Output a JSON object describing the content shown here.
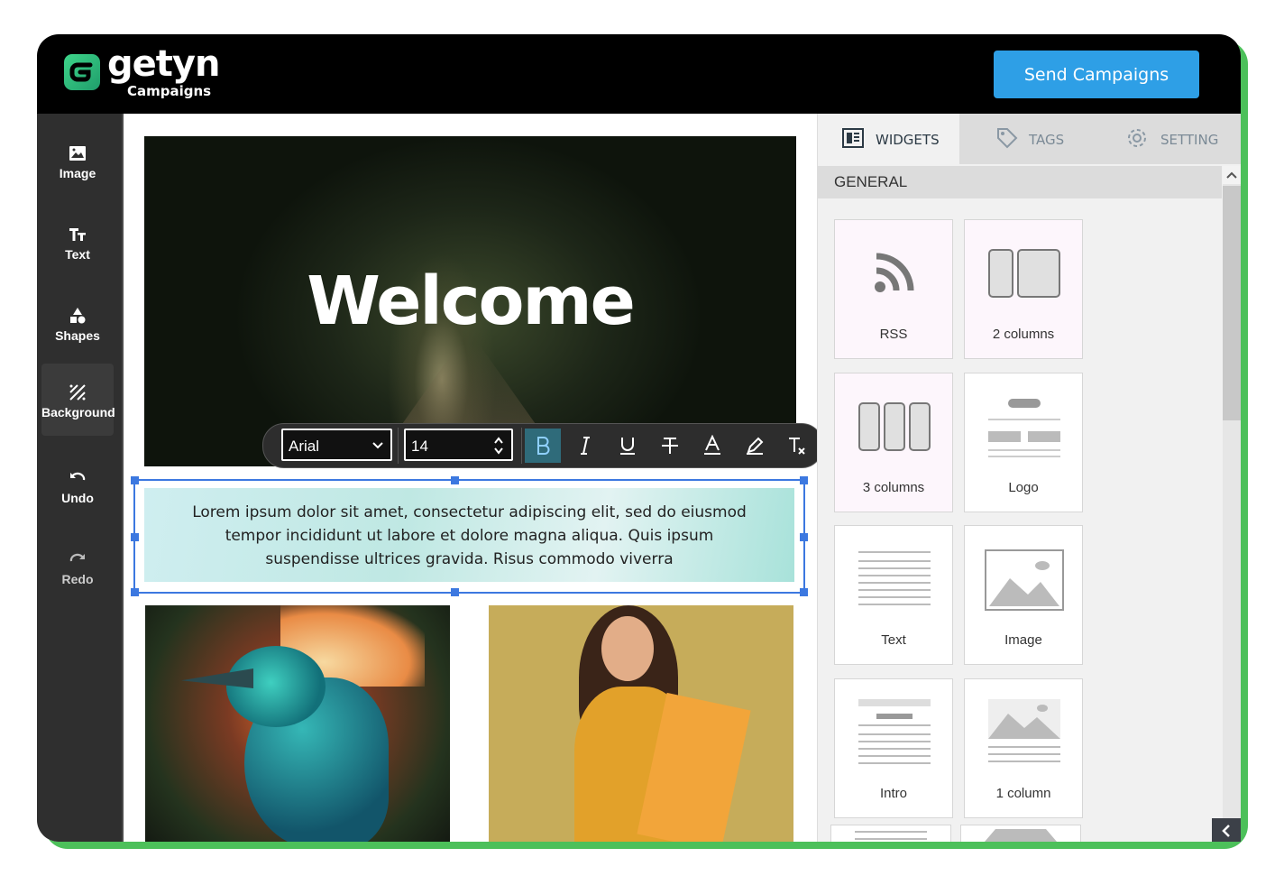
{
  "brand": {
    "name": "getyn",
    "sub": "Campaigns",
    "accent": "#4cc05a"
  },
  "header": {
    "send_label": "Send Campaigns",
    "send_color": "#2e9fe6"
  },
  "sidebar": {
    "items": [
      {
        "label": "Image",
        "icon": "image-icon"
      },
      {
        "label": "Text",
        "icon": "text-icon"
      },
      {
        "label": "Shapes",
        "icon": "shapes-icon"
      },
      {
        "label": "Background",
        "icon": "background-icon"
      },
      {
        "label": "Undo",
        "icon": "undo-icon"
      },
      {
        "label": "Redo",
        "icon": "redo-icon"
      }
    ]
  },
  "canvas": {
    "hero_title": "Welcome",
    "body_text": "Lorem ipsum dolor sit amet, consectetur adipiscing elit, sed do eiusmod tempor incididunt ut labore et dolore magna aliqua. Quis ipsum suspendisse ultrices gravida. Risus commodo viverra"
  },
  "toolbar": {
    "font": "Arial",
    "size": "14",
    "buttons": [
      "bold-icon",
      "italic-icon",
      "underline-icon",
      "strikethrough-icon",
      "text-color-icon",
      "highlight-icon",
      "clear-format-icon"
    ]
  },
  "panel": {
    "tabs": [
      {
        "label": "WIDGETS",
        "icon": "widgets-icon"
      },
      {
        "label": "TAGS",
        "icon": "tag-icon"
      },
      {
        "label": "SETTING",
        "icon": "gear-icon"
      }
    ],
    "section": "GENERAL",
    "widgets": [
      {
        "label": "RSS"
      },
      {
        "label": "2 columns"
      },
      {
        "label": "3 columns"
      },
      {
        "label": "Logo"
      },
      {
        "label": "Text"
      },
      {
        "label": "Image"
      },
      {
        "label": "Intro"
      },
      {
        "label": "1 column"
      }
    ]
  }
}
